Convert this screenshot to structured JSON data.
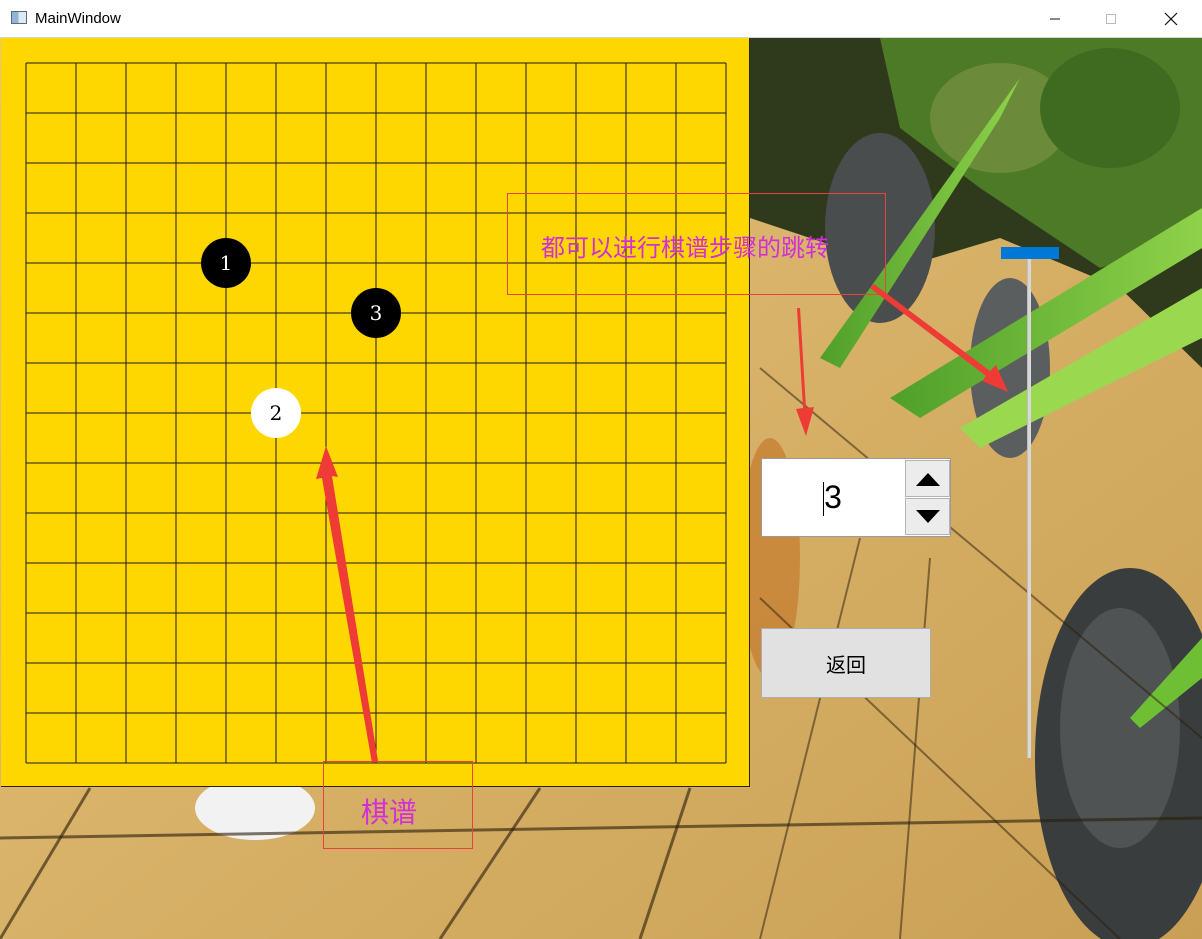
{
  "window": {
    "title": "MainWindow",
    "icon": "app-window-icon",
    "controls": [
      "minimize-icon",
      "maximize-icon",
      "close-icon"
    ]
  },
  "board": {
    "grid_lines": 15,
    "background_color": "#ffd700",
    "line_color": "#1a1a1a",
    "stones": [
      {
        "move": "1",
        "color": "black",
        "col": 4,
        "row": 4
      },
      {
        "move": "2",
        "color": "white",
        "col": 5,
        "row": 7
      },
      {
        "move": "3",
        "color": "black",
        "col": 7,
        "row": 5
      }
    ]
  },
  "annotations": {
    "top_note": "都可以进行棋谱步骤的跳转",
    "bottom_note": "棋谱",
    "text_color": "#d22fd6",
    "box_color": "#e8423e"
  },
  "step_spinbox": {
    "value": "3",
    "up_icon": "triangle-up-icon",
    "down_icon": "triangle-down-icon"
  },
  "back_button": {
    "label": "返回"
  },
  "step_slider": {
    "position_fraction": 0.0,
    "accent_color": "#0078d7"
  }
}
